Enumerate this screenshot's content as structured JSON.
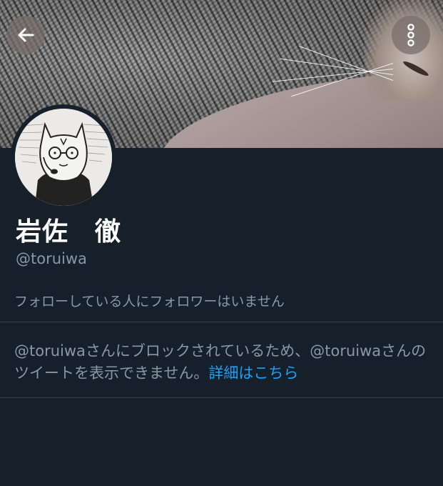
{
  "header": {
    "back_icon": "arrow-left-icon",
    "more_icon": "more-vertical-icon"
  },
  "profile": {
    "display_name": "岩佐　徹",
    "handle": "@toruiwa",
    "follow_note": "フォローしている人にフォロワーはいません"
  },
  "block_notice": {
    "message": "@toruiwaさんにブロックされているため、@toruiwaさんのツイートを表示できません。",
    "link_label": "詳細はこちら",
    "link_color": "#1da1f2"
  },
  "colors": {
    "background": "#15202b",
    "secondary_text": "#8899a6",
    "divider": "#38444d"
  }
}
